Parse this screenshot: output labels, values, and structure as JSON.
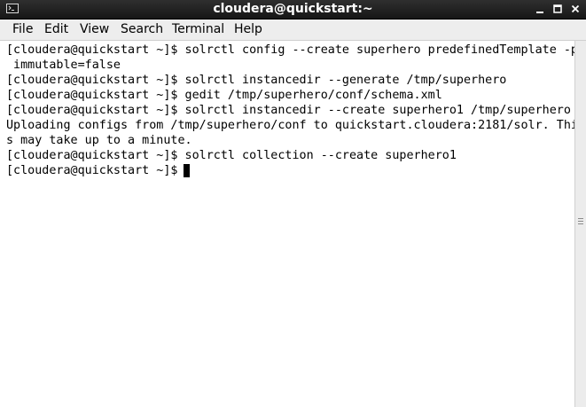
{
  "window": {
    "title": "cloudera@quickstart:~"
  },
  "icons": {
    "app": "terminal-icon",
    "minimize": "minimize-icon",
    "maximize": "maximize-icon",
    "close": "close-icon"
  },
  "menu": {
    "file": "File",
    "edit": "Edit",
    "view": "View",
    "search": "Search",
    "terminal": "Terminal",
    "help": "Help"
  },
  "terminal": {
    "lines": [
      "[cloudera@quickstart ~]$ solrctl config --create superhero predefinedTemplate -p",
      " immutable=false",
      "[cloudera@quickstart ~]$ solrctl instancedir --generate /tmp/superhero",
      "[cloudera@quickstart ~]$ gedit /tmp/superhero/conf/schema.xml",
      "[cloudera@quickstart ~]$ solrctl instancedir --create superhero1 /tmp/superhero",
      "Uploading configs from /tmp/superhero/conf to quickstart.cloudera:2181/solr. Thi",
      "s may take up to a minute.",
      "[cloudera@quickstart ~]$ solrctl collection --create superhero1",
      "[cloudera@quickstart ~]$ "
    ]
  },
  "colors": {
    "titlebar": "#1f1f1f",
    "terminal_bg": "#ffffff",
    "terminal_fg": "#000000",
    "menubar_bg": "#ededed"
  }
}
